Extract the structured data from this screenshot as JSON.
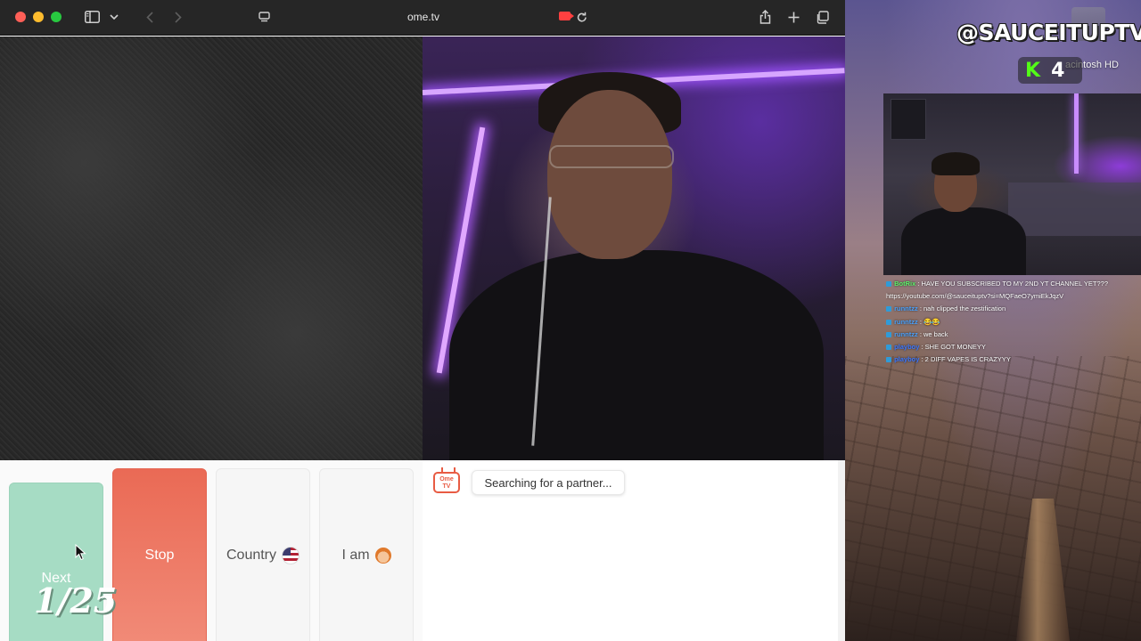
{
  "browser": {
    "url": "ome.tv"
  },
  "controls": {
    "next_label": "Next",
    "stop_label": "Stop",
    "country_label": "Country",
    "iam_label": "I am"
  },
  "chat_panel": {
    "status": "Searching for a partner...",
    "logo_text_line1": "Ome",
    "logo_text_line2": "TV"
  },
  "overlay": {
    "counter": "1/25",
    "handle": "@SAUCEITUPTV",
    "disk_label": "acintosh HD",
    "kick_viewers": "4",
    "kick_logo": "K"
  },
  "stream_chat": [
    {
      "user": "BotRix",
      "text": ": HAVE YOU SUBSCRIBED TO MY 2ND YT CHANNEL YET???",
      "user_color": "#5cf26a"
    },
    {
      "user": "",
      "text": "https://youtube.com/@sauceituptv?si=MQFaeO7ymiEkJqzV",
      "user_color": "#ffffff"
    },
    {
      "user": "runntzz",
      "text": ": nah clipped the zestification",
      "user_color": "#4aa3ff"
    },
    {
      "user": "runntzz",
      "text": ": 😂😂",
      "user_color": "#4aa3ff"
    },
    {
      "user": "runntzz",
      "text": ": we back",
      "user_color": "#4aa3ff"
    },
    {
      "user": "playboy",
      "text": ": SHE GOT MONEYY",
      "user_color": "#3c78ff"
    },
    {
      "user": "playboy",
      "text": ": 2 DIFF VAPES IS CRAZYYY",
      "user_color": "#3c78ff"
    }
  ]
}
